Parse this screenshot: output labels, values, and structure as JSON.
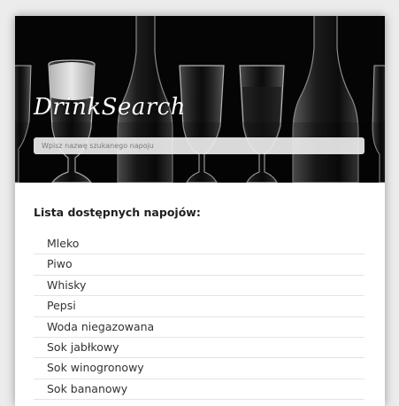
{
  "header": {
    "logo": "DrinkSearch",
    "search_placeholder": "Wpisz nazwę szukanego napoju"
  },
  "list": {
    "title": "Lista dostępnych napojów:",
    "items": [
      "Mleko",
      "Piwo",
      "Whisky",
      "Pepsi",
      "Woda niegazowana",
      "Sok jabłkowy",
      "Sok winogronowy",
      "Sok bananowy"
    ]
  },
  "colors": {
    "page_background": "#ececec",
    "card_background": "#ffffff",
    "hero_background": "#050505",
    "text": "#333333"
  }
}
